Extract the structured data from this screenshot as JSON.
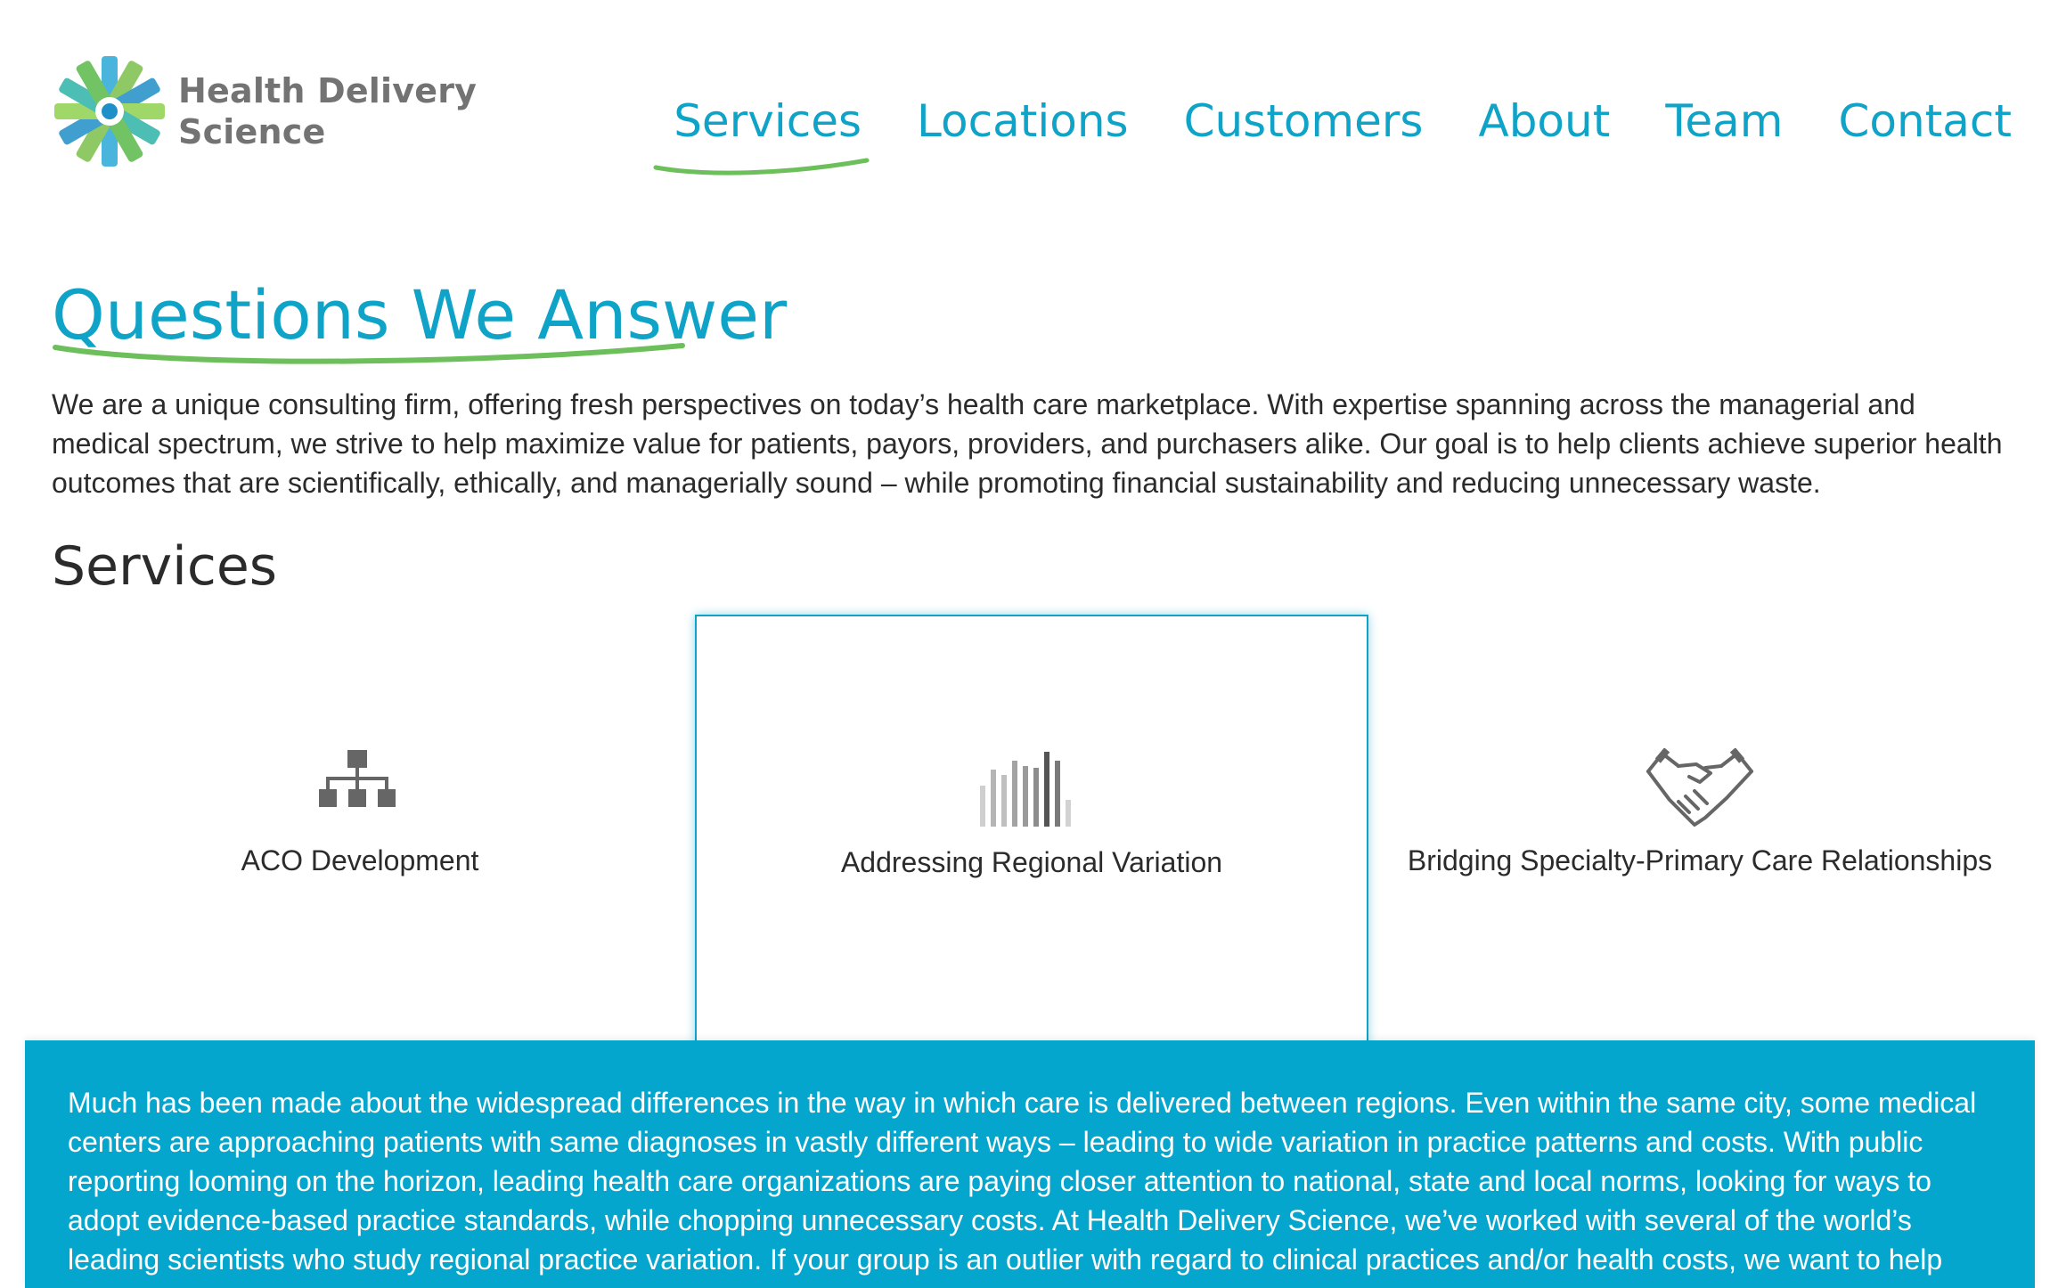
{
  "brand": {
    "line1": "Health Delivery",
    "line2": "Science",
    "colors": {
      "accent": "#0fa3c7",
      "underline": "#6cbf5a",
      "panel": "#05a6cd",
      "logo_text": "#737373"
    }
  },
  "nav": {
    "items": [
      {
        "label": "Services",
        "active": true
      },
      {
        "label": "Locations",
        "active": false
      },
      {
        "label": "Customers",
        "active": false
      },
      {
        "label": "About",
        "active": false
      },
      {
        "label": "Team",
        "active": false
      },
      {
        "label": "Contact",
        "active": false
      }
    ]
  },
  "page": {
    "title": "Questions We Answer",
    "intro": "We are a unique consulting firm, offering fresh perspectives on today’s health care marketplace. With expertise spanning across the managerial and medical spectrum, we strive to help maximize value for patients, payors, providers, and purchasers alike. Our goal is to help clients achieve superior health outcomes that are scientifically, ethically, and managerially sound – while promoting financial sustainability and reducing unnecessary waste."
  },
  "services": {
    "heading": "Services",
    "cards": [
      {
        "label": "ACO Development",
        "icon": "org-chart-icon",
        "selected": false
      },
      {
        "label": "Addressing Regional Variation",
        "icon": "bar-chart-icon",
        "selected": true
      },
      {
        "label": "Bridging Specialty-Primary Care Relationships",
        "icon": "handshake-icon",
        "selected": false
      }
    ],
    "detail": "Much has been made about the widespread differences in the way in which care is delivered between regions. Even within the same city, some medical centers are approaching patients with same diagnoses in vastly different ways – leading to wide variation in practice patterns and costs. With public reporting looming on the horizon, leading health care organizations are paying closer attention to national, state and local norms, looking for ways to adopt evidence-based practice standards, while chopping unnecessary costs. At Health Delivery Science, we’ve worked with several of the world’s leading scientists who study regional practice variation. If your group is an outlier with regard to clinical practices and/or health costs, we want to help"
  }
}
